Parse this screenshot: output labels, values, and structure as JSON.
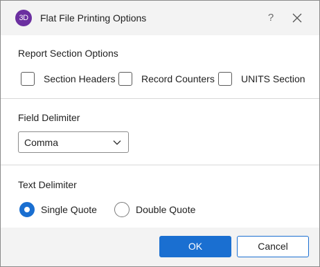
{
  "window": {
    "app_icon_text": "3D",
    "title": "Flat File Printing Options",
    "help_label": "?"
  },
  "report_section": {
    "title": "Report Section Options",
    "options": [
      {
        "label": "Section Headers",
        "checked": false
      },
      {
        "label": "Record Counters",
        "checked": false
      },
      {
        "label": "UNITS Section",
        "checked": false
      }
    ]
  },
  "field_delimiter": {
    "title": "Field Delimiter",
    "selected": "Comma"
  },
  "text_delimiter": {
    "title": "Text Delimiter",
    "options": [
      {
        "label": "Single Quote",
        "selected": true
      },
      {
        "label": "Double Quote",
        "selected": false
      }
    ]
  },
  "buttons": {
    "ok": "OK",
    "cancel": "Cancel"
  },
  "colors": {
    "accent": "#1a6fd1",
    "app_icon": "#6b2fa0"
  }
}
